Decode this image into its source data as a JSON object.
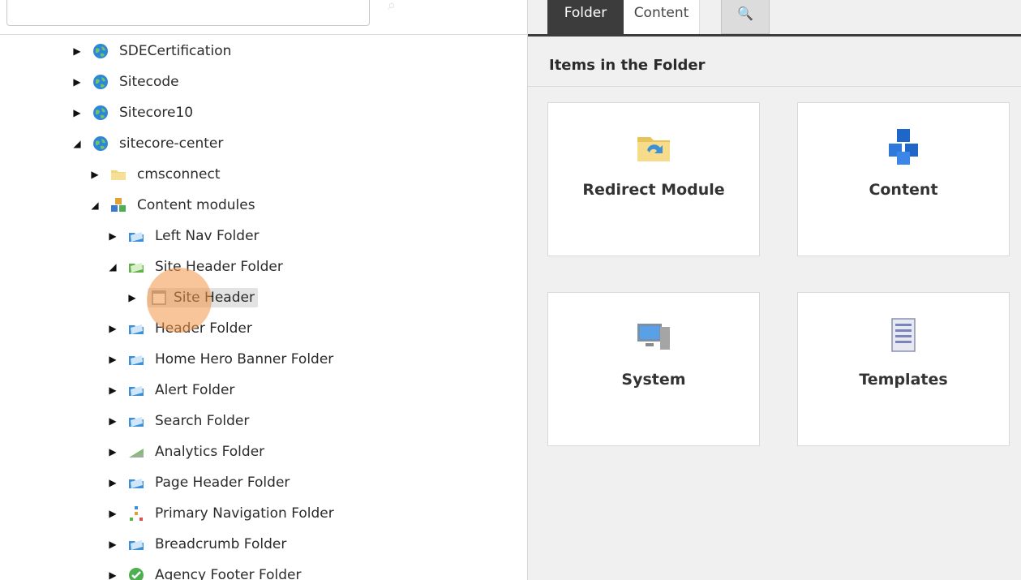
{
  "tree": {
    "items": [
      {
        "label": "SDECertification",
        "icon": "globe-icon",
        "state": "collapsed"
      },
      {
        "label": "Sitecode",
        "icon": "globe-icon",
        "state": "collapsed"
      },
      {
        "label": "Sitecore10",
        "icon": "globe-icon",
        "state": "collapsed"
      },
      {
        "label": "sitecore-center",
        "icon": "globe-icon",
        "state": "expanded"
      },
      {
        "label": "cmsconnect",
        "icon": "folder-icon",
        "state": "collapsed"
      },
      {
        "label": "Content modules",
        "icon": "cubes-icon",
        "state": "expanded"
      },
      {
        "label": "Left Nav Folder",
        "icon": "blue-folder-icon",
        "state": "collapsed"
      },
      {
        "label": "Site Header Folder",
        "icon": "green-folder-icon",
        "state": "expanded"
      },
      {
        "label": "Site Header",
        "icon": "page-icon",
        "state": "collapsed",
        "selected": true
      },
      {
        "label": "Header Folder",
        "icon": "blue-folder-icon",
        "state": "collapsed"
      },
      {
        "label": "Home Hero Banner Folder",
        "icon": "blue-folder-icon",
        "state": "collapsed"
      },
      {
        "label": "Alert Folder",
        "icon": "blue-folder-icon",
        "state": "collapsed"
      },
      {
        "label": "Search Folder",
        "icon": "blue-folder-icon",
        "state": "collapsed"
      },
      {
        "label": "Analytics Folder",
        "icon": "chart-icon",
        "state": "collapsed"
      },
      {
        "label": "Page Header Folder",
        "icon": "blue-folder-icon",
        "state": "collapsed"
      },
      {
        "label": "Primary Navigation Folder",
        "icon": "sitemap-icon",
        "state": "collapsed"
      },
      {
        "label": "Breadcrumb Folder",
        "icon": "blue-folder-icon",
        "state": "collapsed"
      },
      {
        "label": "Agency Footer Folder",
        "icon": "green-check-icon",
        "state": "collapsed"
      }
    ]
  },
  "tabs": {
    "folder": "Folder",
    "content": "Content",
    "search_icon": "🔍"
  },
  "main": {
    "section_title": "Items in the Folder",
    "cards": [
      {
        "label": "Redirect Module",
        "icon": "redirect-folder-icon"
      },
      {
        "label": "Content",
        "icon": "blue-cubes-icon"
      },
      {
        "label": "System",
        "icon": "computer-icon"
      },
      {
        "label": "Templates",
        "icon": "document-list-icon"
      }
    ]
  },
  "colors": {
    "accent_tab": "#3c3c3c",
    "selection": "#e3e3e3",
    "click_highlight": "#f0964a"
  }
}
